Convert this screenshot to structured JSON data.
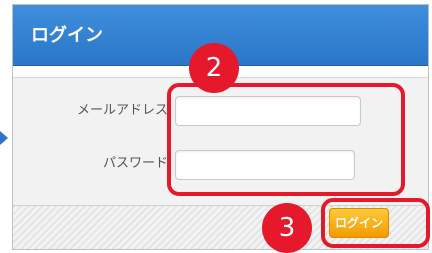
{
  "dialog": {
    "title": "ログイン"
  },
  "form": {
    "email_label": "メールアドレス",
    "email_value": "",
    "password_label": "パスワード",
    "password_value": ""
  },
  "actions": {
    "login_label": "ログイン"
  },
  "annotations": {
    "step_2": "2",
    "step_3": "3"
  },
  "colors": {
    "header_blue": "#2a76c8",
    "accent_orange": "#f39b00",
    "annotation_red": "#e5192b"
  }
}
